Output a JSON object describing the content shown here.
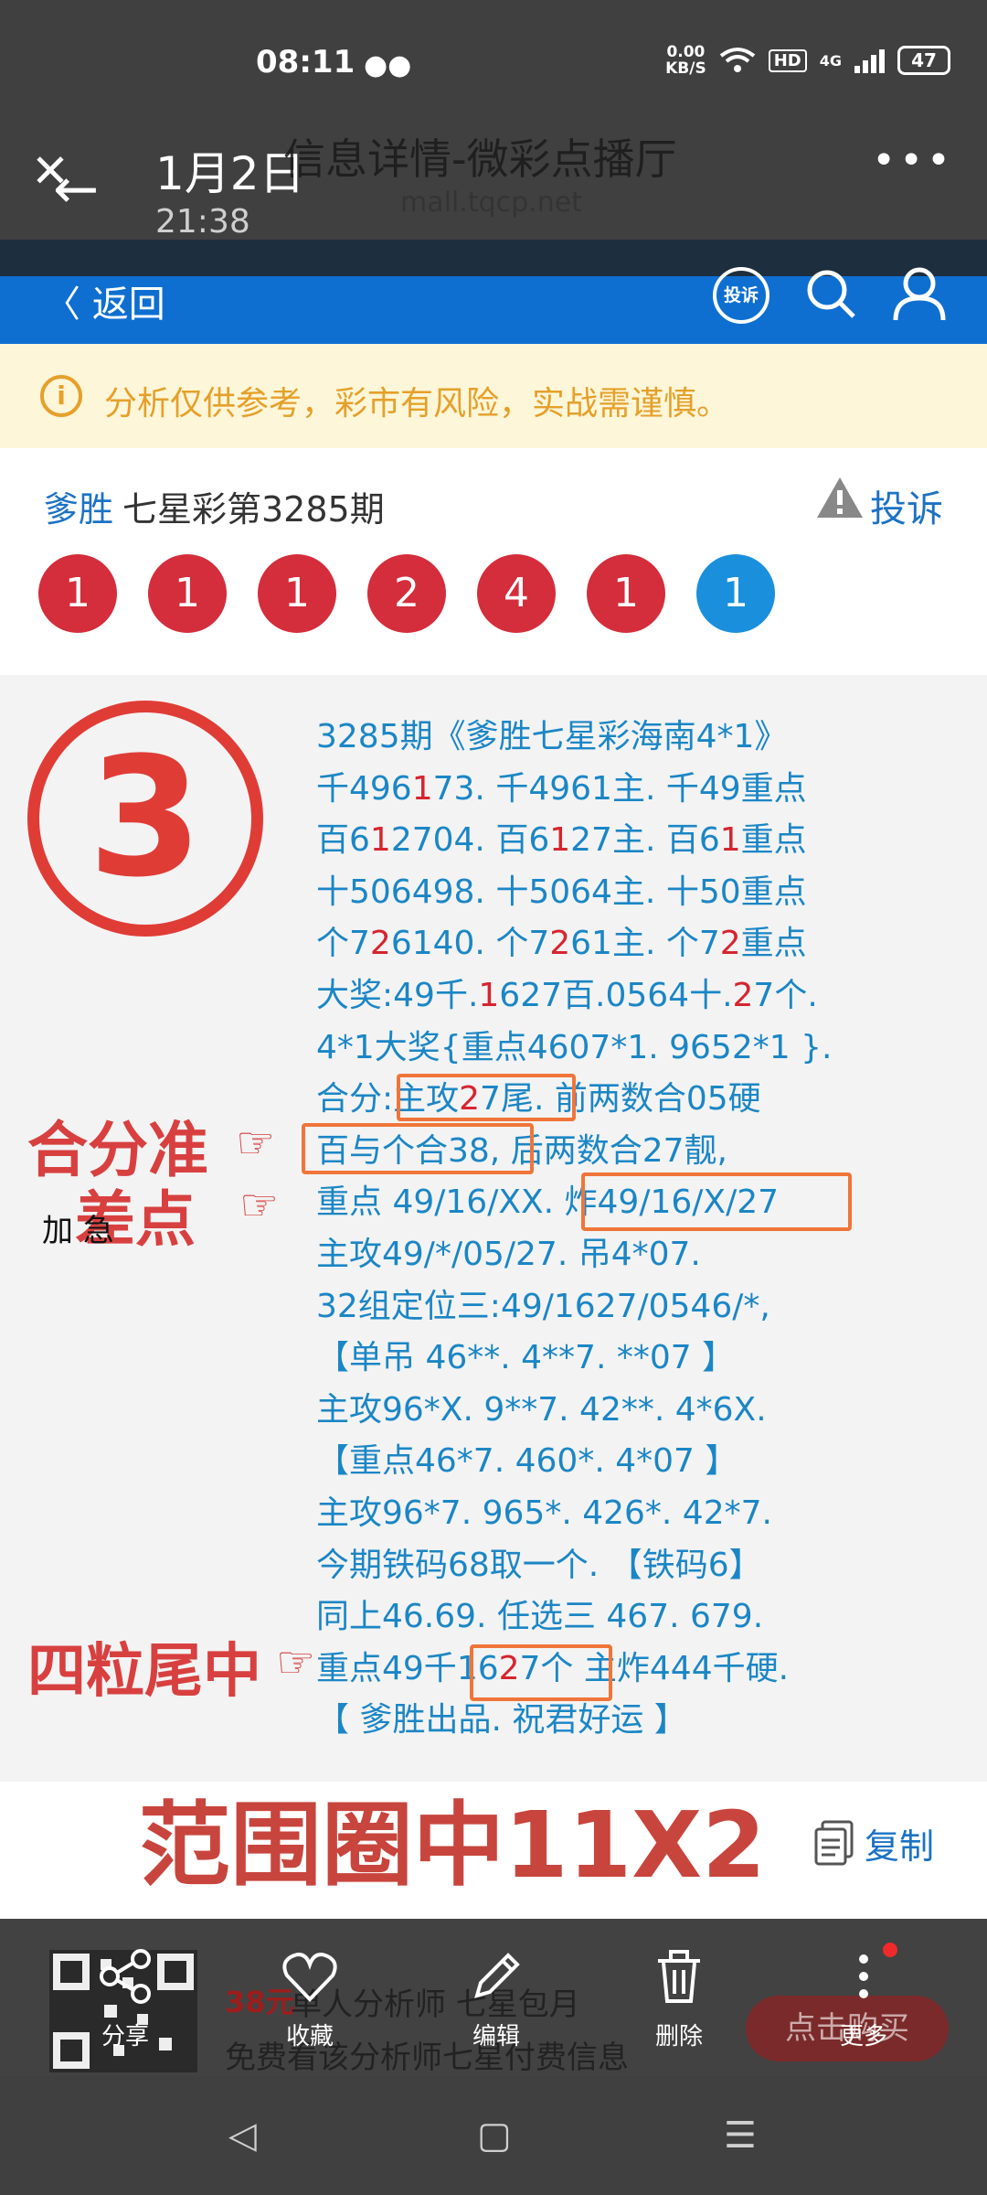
{
  "status_bar": {
    "time": "08:11",
    "net_speed_value": "0.00",
    "net_speed_unit": "KB/S",
    "hd": "HD",
    "network": "4G",
    "battery": "47"
  },
  "viewer": {
    "date": "1月2日",
    "time": "21:38",
    "page_title": "信息详情-微彩点播厅",
    "url": "mall.tqcp.net",
    "more": "•••"
  },
  "app_nav": {
    "back_label": "返回",
    "complain_label": "投诉"
  },
  "notice": {
    "text": "分析仅供参考，彩市有风险，实战需谨慎。"
  },
  "result": {
    "analyst": "爹胜",
    "title": "七星彩第3285期",
    "report_label": "投诉",
    "balls": [
      "1",
      "1",
      "1",
      "2",
      "4",
      "1",
      "1"
    ]
  },
  "annotations": {
    "circle_number": "③",
    "accurate_sum": "合分准",
    "near_miss": "差点",
    "four_tails": "四粒尾中",
    "jia_ji": "加 急",
    "range_hit": "范围圈中11X2"
  },
  "post": {
    "lines": [
      [
        {
          "t": "3285期《爹胜七星彩海南4*1》"
        }
      ],
      [
        {
          "t": "千496"
        },
        {
          "t": "1",
          "r": true
        },
        {
          "t": "73. 千4961"
        },
        {
          "t": "主. 千49重点"
        }
      ],
      [
        {
          "t": "百6"
        },
        {
          "t": "1",
          "r": true
        },
        {
          "t": "2704. 百6"
        },
        {
          "t": "1",
          "r": true
        },
        {
          "t": "27主. 百6"
        },
        {
          "t": "1",
          "r": true
        },
        {
          "t": "重点"
        }
      ],
      [
        {
          "t": "十506498. 十5064主. 十50重点"
        }
      ],
      [
        {
          "t": "个7"
        },
        {
          "t": "2",
          "r": true
        },
        {
          "t": "6140. 个7"
        },
        {
          "t": "2",
          "r": true
        },
        {
          "t": "61主. 个7"
        },
        {
          "t": "2",
          "r": true
        },
        {
          "t": "重点"
        }
      ],
      [
        {
          "t": "大奖:49千."
        },
        {
          "t": "1",
          "r": true
        },
        {
          "t": "627百.0564十."
        },
        {
          "t": "2",
          "r": true
        },
        {
          "t": "7个."
        }
      ],
      [
        {
          "t": "4*1大奖{重点4607*1. 9652*1 }."
        }
      ],
      [
        {
          "t": "合分:主攻"
        },
        {
          "t": "2",
          "r": true
        },
        {
          "t": "7尾. 前两数合05硬"
        }
      ],
      [
        {
          "t": "百与个合38, 后两数合27靓,"
        }
      ],
      [
        {
          "t": "重点 49/16/XX. 炸49/16/X/27"
        }
      ],
      [
        {
          "t": "主攻49/*/05/27. 吊4*07."
        }
      ],
      [
        {
          "t": "32组定位三:49/1627/0546/*,"
        }
      ],
      [
        {
          "t": "【单吊 46**. 4**7. **07 】"
        }
      ],
      [
        {
          "t": "主攻96*X. 9**7. 42**. 4*6X."
        }
      ],
      [
        {
          "t": "【重点46*7. 460*. 4*07 】"
        }
      ],
      [
        {
          "t": "主攻96*7. 965*. 426*. 42*7."
        }
      ],
      [
        {
          "t": "今期铁码68取一个. 【铁码6】"
        }
      ],
      [
        {
          "t": "同上46.69. 任选三 467. 679."
        }
      ],
      [
        {
          "t": "重点49千"
        },
        {
          "t": "16"
        },
        {
          "t": "2",
          "r": true
        },
        {
          "t": "7个 主炸444千硬."
        }
      ],
      [
        {
          "t": "【 爹胜出品. 祝君好运 】"
        }
      ]
    ]
  },
  "copy_label": "复制",
  "promo": {
    "price": "38元",
    "title": "单人分析师 七星包月",
    "subtitle": "免费看该分析师七星付费信息",
    "buy_label": "点击购买"
  },
  "bottom_actions": {
    "share": "分享",
    "favorite": "收藏",
    "edit": "编辑",
    "delete": "删除",
    "more": "更多"
  },
  "colors": {
    "accent_blue": "#0e6fd1",
    "ball_red": "#d42d3b",
    "ball_blue": "#1a8fdc",
    "annotation_red": "#d84040",
    "highlight_orange": "#f0753a"
  }
}
